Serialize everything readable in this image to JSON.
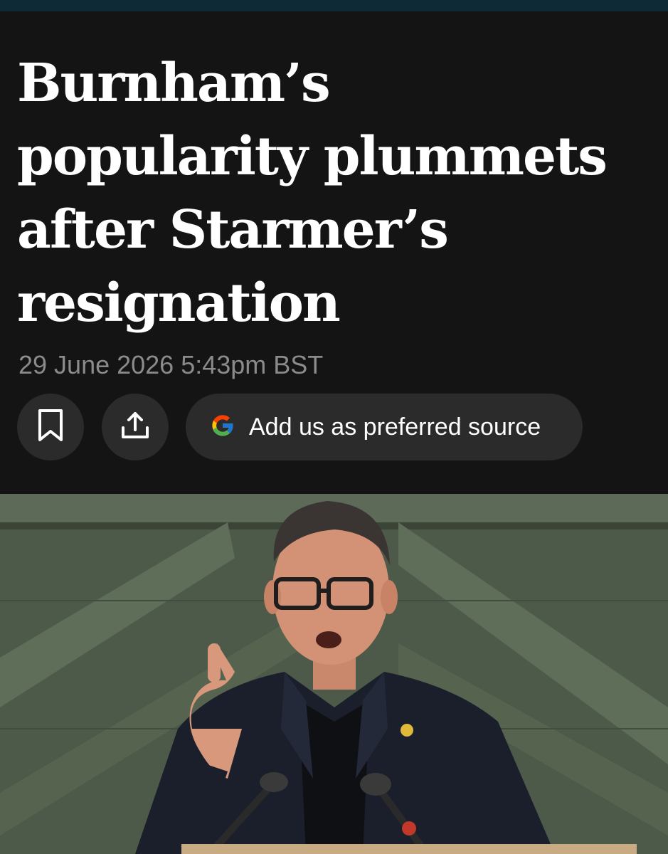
{
  "article": {
    "headline": "Burnham’s\npopularity plummets\nafter Starmer’s\nresignation",
    "timestamp": "29 June 2026 5:43pm BST"
  },
  "actions": {
    "bookmark_icon": "bookmark-icon",
    "share_icon": "share-icon",
    "preferred_source_label": "Add us as preferred source",
    "preferred_source_icon": "google-g-icon"
  },
  "colors": {
    "background": "#141414",
    "top_bar": "#0e2a36",
    "headline": "#ffffff",
    "timestamp": "#8b8b8b",
    "button_bg": "#2b2b2b",
    "wall_green": "#55624f"
  }
}
